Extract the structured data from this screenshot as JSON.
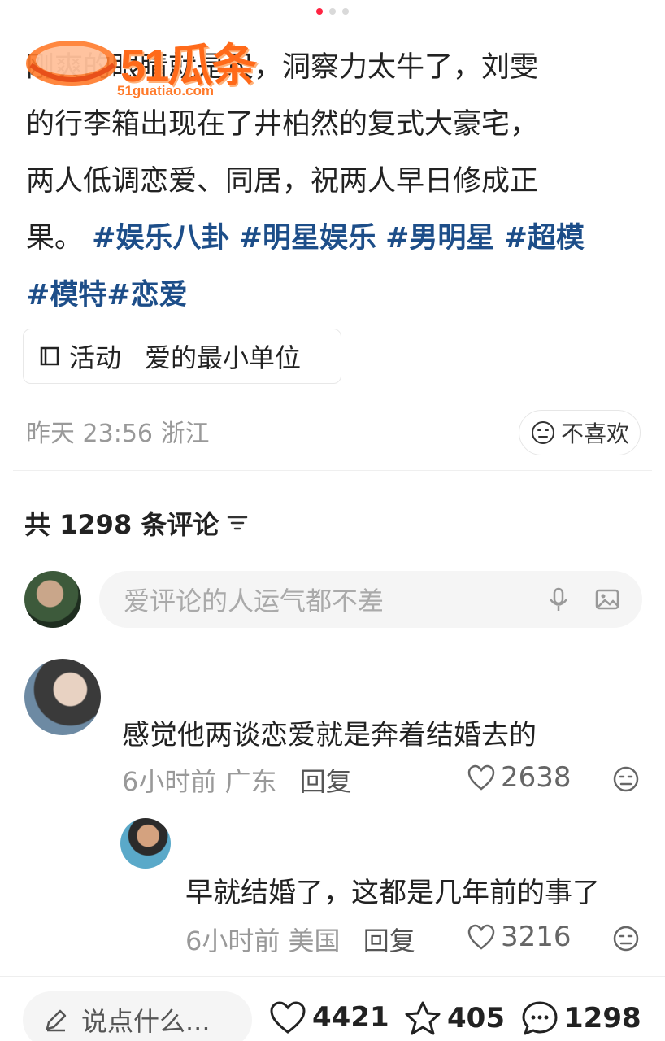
{
  "watermark": {
    "brand": "51瓜条",
    "domain": "51guatiao.com"
  },
  "post": {
    "text_line1": "刚爽的眼睛就是尺，洞察力太牛了，刘雯",
    "text_line2": "的行李箱出现在了井柏然的复式大豪宅，",
    "text_line3": "两人低调恋爱、同居，祝两人早日修成正",
    "text_line4_start": "果。",
    "tags": [
      "#娱乐八卦",
      "#明星娱乐",
      "#男明星",
      "#超模",
      "#模特",
      "#恋爱"
    ],
    "activity_label": "活动",
    "activity_name": "爱的最小单位",
    "time_location": "昨天 23:56 浙江",
    "dislike_label": "不喜欢"
  },
  "comments_header": {
    "label": "共 1298 条评论"
  },
  "input": {
    "placeholder": "爱评论的人运气都不差"
  },
  "comments": [
    {
      "text": "感觉他两谈恋爱就是奔着结婚去的",
      "time": "6小时前",
      "location": "广东",
      "reply": "回复",
      "likes": "2638"
    },
    {
      "text": "早就结婚了，这都是几年前的事了",
      "time": "6小时前",
      "location": "美国",
      "reply": "回复",
      "likes": "3216"
    }
  ],
  "bottom": {
    "say_placeholder": "说点什么...",
    "likes": "4421",
    "stars": "405",
    "comments": "1298"
  },
  "colors": {
    "accent": "#ff2442",
    "tag": "#1d4e89",
    "watermark": "#ff6a1a"
  }
}
